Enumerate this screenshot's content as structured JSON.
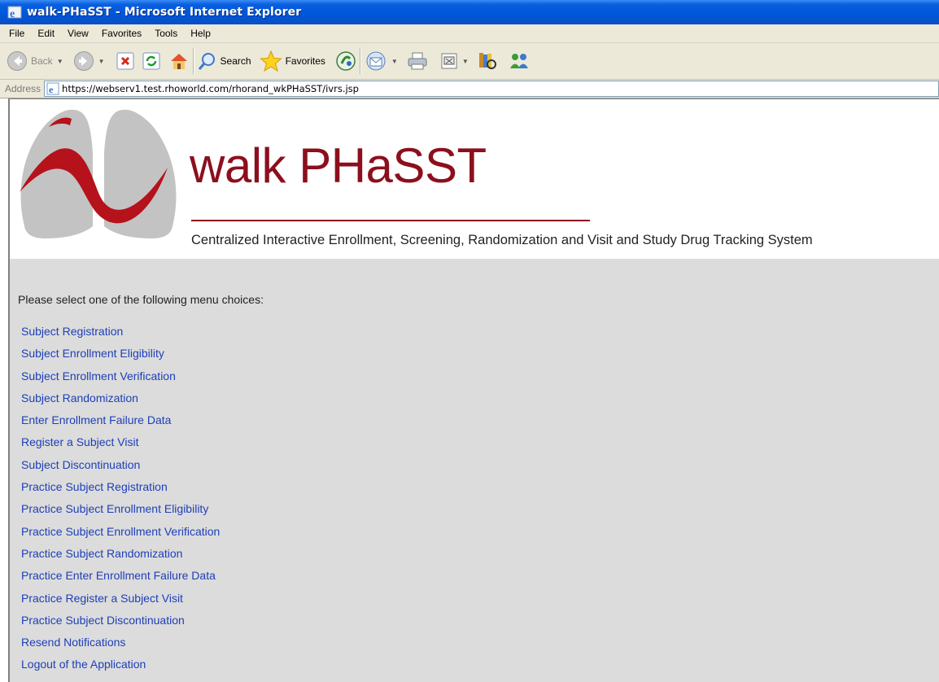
{
  "window": {
    "title": "walk-PHaSST - Microsoft Internet Explorer"
  },
  "menubar": {
    "items": [
      "File",
      "Edit",
      "View",
      "Favorites",
      "Tools",
      "Help"
    ]
  },
  "toolbar": {
    "back_label": "Back",
    "search_label": "Search",
    "favorites_label": "Favorites"
  },
  "address": {
    "label": "Address",
    "url": "https://webserv1.test.rhoworld.com/rhorand_wkPHaSST/ivrs.jsp"
  },
  "banner": {
    "title": "walk PHaSST",
    "subtitle": "Centralized Interactive Enrollment, Screening, Randomization and Visit and Study Drug Tracking System",
    "brand_color": "#8c0f1d"
  },
  "page": {
    "prompt": "Please select one of the following menu choices:",
    "link_color": "#1d3fb8",
    "links": [
      "Subject Registration",
      "Subject Enrollment Eligibility",
      "Subject Enrollment Verification",
      "Subject Randomization",
      "Enter Enrollment Failure Data",
      "Register a Subject Visit",
      "Subject Discontinuation",
      "Practice Subject Registration",
      "Practice Subject Enrollment Eligibility",
      "Practice Subject Enrollment Verification",
      "Practice Subject Randomization",
      "Practice Enter Enrollment Failure Data",
      "Practice Register a Subject Visit",
      "Practice Subject Discontinuation",
      "Resend Notifications",
      "Logout of the Application"
    ]
  }
}
